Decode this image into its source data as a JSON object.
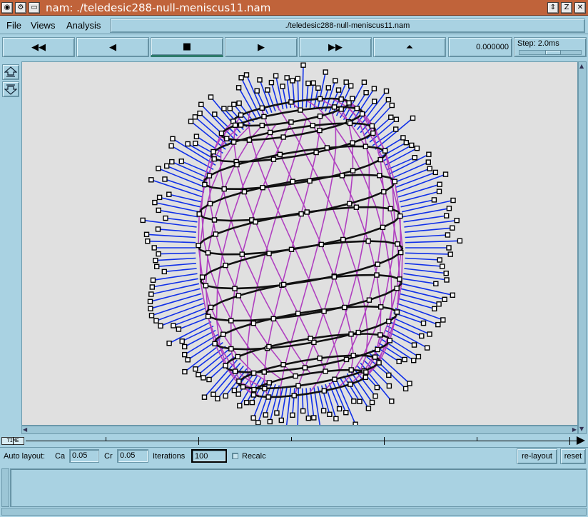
{
  "window": {
    "title": "nam: ./teledesic288-null-meniscus11.nam"
  },
  "menu": {
    "file": "File",
    "views": "Views",
    "analysis": "Analysis",
    "filename": "./teledesic288-null-meniscus11.nam"
  },
  "toolbar": {
    "rewind": "◀◀",
    "back": "◀",
    "stop": "■",
    "play": "▶",
    "fast_forward": "▶▶",
    "eject": "⏶",
    "time": "0.000000",
    "step_label": "Step: 2.0ms"
  },
  "timeline": {
    "tag": "TIME"
  },
  "autolayout": {
    "label": "Auto layout:",
    "ca_label": "Ca",
    "ca_value": "0.05",
    "cr_label": "Cr",
    "cr_value": "0.05",
    "iterations_label": "Iterations",
    "iterations_value": "100",
    "recalc_label": "Recalc",
    "relayout_label": "re-layout",
    "reset_label": "reset"
  },
  "colors": {
    "background": "#a9d2e2",
    "titlebar": "#c0633a",
    "canvas": "#e0e0e0",
    "ring_link": "#111111",
    "inter_link": "#b040c0",
    "spoke_link": "#1030e8"
  },
  "icons": {
    "zoom_in": "zoom-in-icon",
    "zoom_out": "zoom-out-icon"
  }
}
